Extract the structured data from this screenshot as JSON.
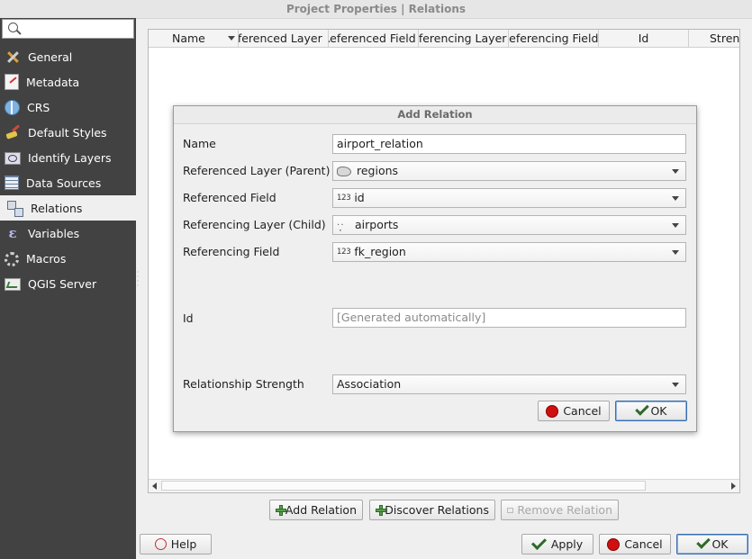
{
  "window": {
    "title": "Project Properties | Relations"
  },
  "search": {
    "placeholder": ""
  },
  "sidebar": {
    "items": [
      {
        "label": "General",
        "icon": "tools-icon"
      },
      {
        "label": "Metadata",
        "icon": "metadata-icon"
      },
      {
        "label": "CRS",
        "icon": "globe-icon"
      },
      {
        "label": "Default Styles",
        "icon": "brush-icon"
      },
      {
        "label": "Identify Layers",
        "icon": "identify-icon"
      },
      {
        "label": "Data Sources",
        "icon": "table-icon"
      },
      {
        "label": "Relations",
        "icon": "relations-icon",
        "active": true
      },
      {
        "label": "Variables",
        "icon": "variables-icon"
      },
      {
        "label": "Macros",
        "icon": "gear-icon"
      },
      {
        "label": "QGIS Server",
        "icon": "server-icon"
      }
    ]
  },
  "table": {
    "columns": [
      "Name",
      "Referenced Layer",
      "Referenced Field",
      "Referencing Layer",
      "Referencing Field",
      "Id",
      "Strength"
    ]
  },
  "buttons": {
    "add_relation": "Add Relation",
    "discover_relations": "Discover Relations",
    "remove_relation": "Remove Relation",
    "help": "Help",
    "apply": "Apply",
    "cancel": "Cancel",
    "ok": "OK"
  },
  "dialog": {
    "title": "Add Relation",
    "name_label": "Name",
    "name_value": "airport_relation",
    "referenced_layer_label": "Referenced Layer (Parent)",
    "referenced_layer_value": "regions",
    "referenced_field_label": "Referenced Field",
    "referenced_field_value": "id",
    "referencing_layer_label": "Referencing Layer (Child)",
    "referencing_layer_value": "airports",
    "referencing_field_label": "Referencing Field",
    "referencing_field_value": "fk_region",
    "id_label": "Id",
    "id_placeholder": "[Generated automatically]",
    "strength_label": "Relationship Strength",
    "strength_value": "Association",
    "field_type_badge": "123",
    "cancel": "Cancel",
    "ok": "OK"
  }
}
